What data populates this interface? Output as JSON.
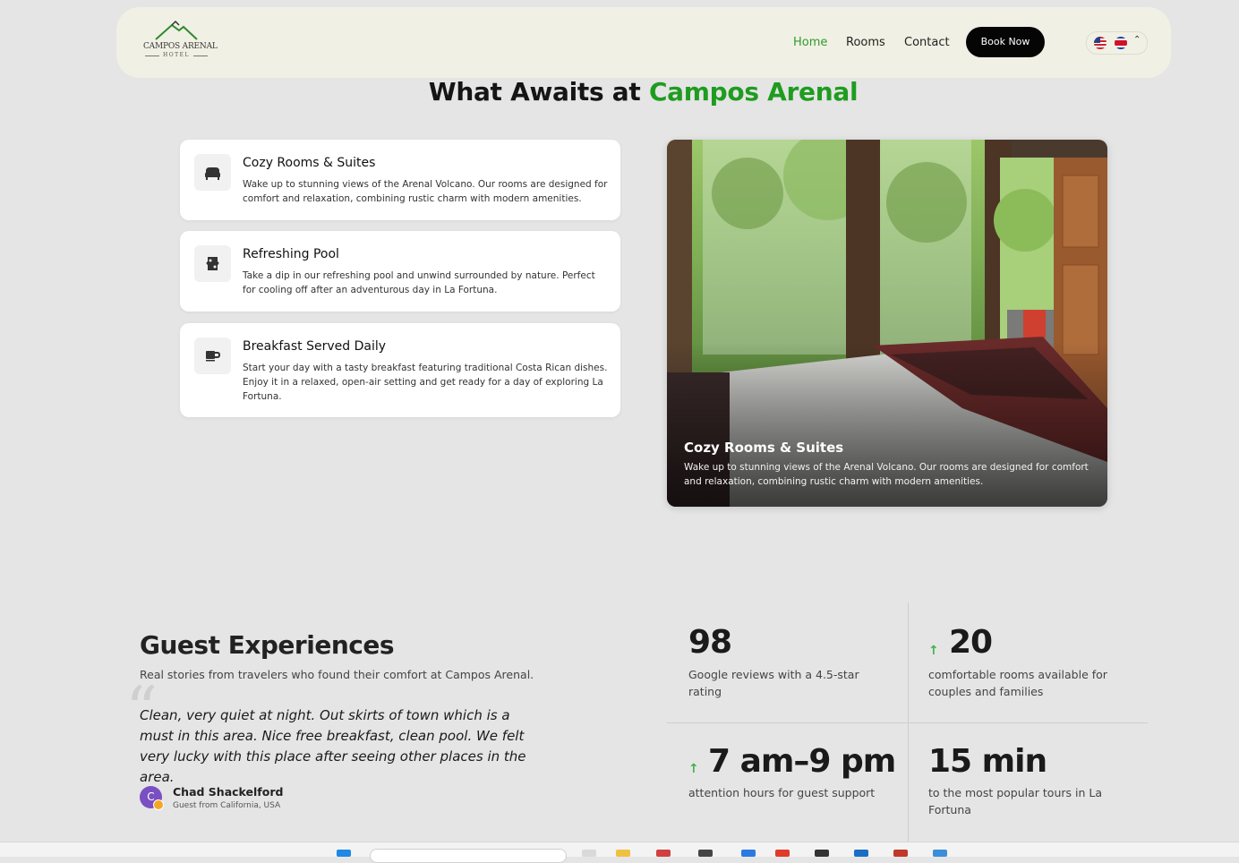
{
  "nav": {
    "logo_name": "CAMPOS ARENAL",
    "logo_sub": "HOTEL",
    "links": [
      "Home",
      "Rooms",
      "Contact"
    ],
    "active": "Home",
    "book_label": "Book Now",
    "languages": [
      "English",
      "Español"
    ]
  },
  "features": {
    "title_prefix": "What Awaits at ",
    "title_accent": "Campos Arenal",
    "items": [
      {
        "icon": "bed-icon",
        "title": "Cozy Rooms & Suites",
        "desc": "Wake up to stunning views of the Arenal Volcano. Our rooms are designed for comfort and relaxation, combining rustic charm with modern amenities."
      },
      {
        "icon": "pool-icon",
        "title": "Refreshing Pool",
        "desc": "Take a dip in our refreshing pool and unwind surrounded by nature. Perfect for cooling off after an adventurous day in La Fortuna."
      },
      {
        "icon": "coffee-icon",
        "title": "Breakfast Served Daily",
        "desc": "Start your day with a tasty breakfast featuring traditional Costa Rican dishes. Enjoy it in a relaxed, open-air setting and get ready for a day of exploring La Fortuna."
      }
    ],
    "photo_caption": {
      "title": "Cozy Rooms & Suites",
      "desc": "Wake up to stunning views of the Arenal Volcano. Our rooms are designed for comfort and relaxation, combining rustic charm with modern amenities."
    }
  },
  "guest": {
    "title": "Guest Experiences",
    "subtitle": "Real stories from travelers who found their comfort at Campos Arenal.",
    "quote": "Clean, very quiet at night. Out skirts of town which is a must in this area. Nice free breakfast, clean pool. We felt very lucky with this place after seeing other places in the area.",
    "author": "Chad Shackelford",
    "author_initial": "C",
    "author_from": "Guest from California, USA"
  },
  "stats": [
    {
      "value": "98",
      "label": "Google reviews with a 4.5-star rating",
      "arrow": false
    },
    {
      "value": "20",
      "label": "comfortable rooms available for couples and families",
      "arrow": true
    },
    {
      "value": "7 am–9 pm",
      "label": "attention hours for guest support",
      "arrow": true
    },
    {
      "value": "15 min",
      "label": "to the most popular tours in La Fortuna",
      "arrow": false
    }
  ],
  "colors": {
    "accent": "#1f9c1f",
    "nav_bg": "#f1f0e4",
    "page_bg": "#e5e5e5",
    "button": "#050505"
  }
}
